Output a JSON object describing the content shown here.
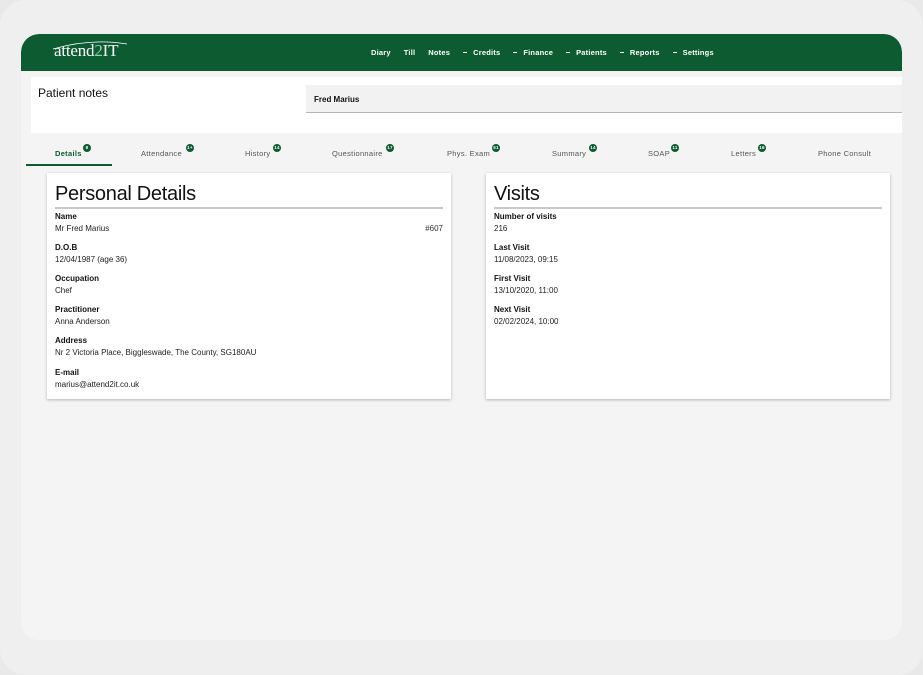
{
  "app": {
    "logo_text_left": "attend",
    "logo_text_accent": "2",
    "logo_text_right": "IT",
    "accent_color": "#0d5b31"
  },
  "nav": {
    "items": [
      {
        "label": "Diary",
        "dropdown": false
      },
      {
        "label": "Till",
        "dropdown": false
      },
      {
        "label": "Notes",
        "dropdown": false
      },
      {
        "label": "Credits",
        "dropdown": true
      },
      {
        "label": "Finance",
        "dropdown": true
      },
      {
        "label": "Patients",
        "dropdown": true
      },
      {
        "label": "Reports",
        "dropdown": true
      },
      {
        "label": "Settings",
        "dropdown": true
      }
    ]
  },
  "header": {
    "title": "Patient notes",
    "patient_name": "Fred Marius"
  },
  "tabs": [
    {
      "label": "Details",
      "badge": "8"
    },
    {
      "label": "Attendance",
      "badge": "1+"
    },
    {
      "label": "History",
      "badge": "14"
    },
    {
      "label": "Questionnaire",
      "badge": "17"
    },
    {
      "label": "Phys. Exam",
      "badge": "51"
    },
    {
      "label": "Summary",
      "badge": "14"
    },
    {
      "label": "SOAP",
      "badge": "11"
    },
    {
      "label": "Letters",
      "badge": "16"
    },
    {
      "label": "Phone Consult",
      "badge": ""
    }
  ],
  "personal_details": {
    "title": "Personal Details",
    "patient_id": "#607",
    "fields": [
      {
        "label": "Name",
        "value": "Mr Fred Marius"
      },
      {
        "label": "D.O.B",
        "value": "12/04/1987 (age 36)"
      },
      {
        "label": "Occupation",
        "value": "Chef"
      },
      {
        "label": "Practitioner",
        "value": "Anna Anderson"
      },
      {
        "label": "Address",
        "value": "Nr 2 Victoria Place, Biggleswade, The County, SG180AU"
      },
      {
        "label": "E-mail",
        "value": "marius@attend2it.co.uk"
      }
    ]
  },
  "visits": {
    "title": "Visits",
    "fields": [
      {
        "label": "Number of visits",
        "value": "216"
      },
      {
        "label": "Last Visit",
        "value": "11/08/2023, 09:15"
      },
      {
        "label": "First Visit",
        "value": "13/10/2020, 11:00"
      },
      {
        "label": "Next Visit",
        "value": "02/02/2024, 10:00"
      }
    ]
  }
}
